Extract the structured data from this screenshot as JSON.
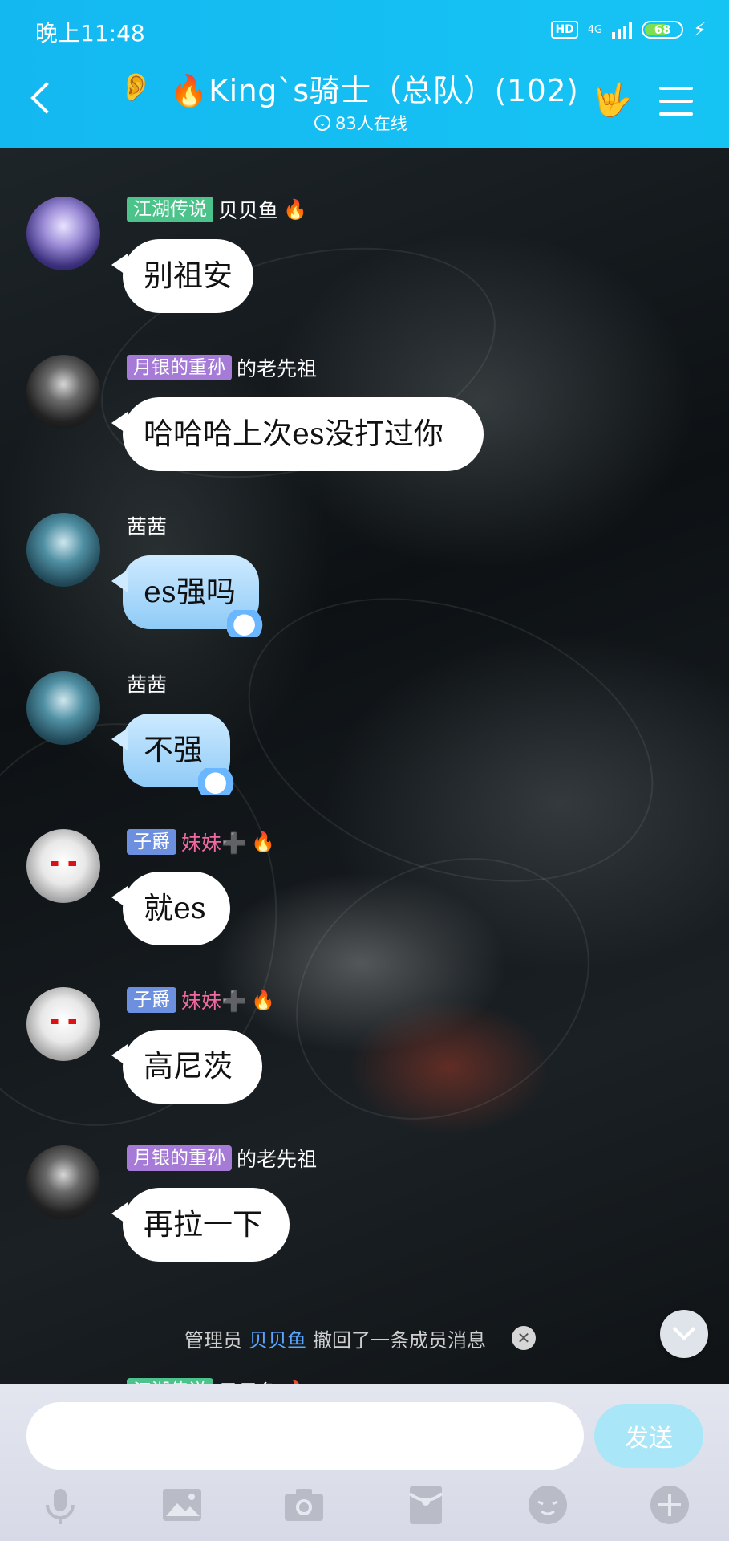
{
  "status_bar": {
    "time": "晚上11:48",
    "hd": "HD",
    "network": "4G",
    "battery": "68",
    "battery_level": 0.68
  },
  "header": {
    "title": "🔥King`s骑士（总队）(102)",
    "online": "83人在线"
  },
  "messages": [
    {
      "badge": "江湖传说",
      "badge_color": "#4cc38a",
      "nick": "贝贝鱼",
      "emoji": "🔥",
      "text": "别祖安",
      "avatar_style": "purple",
      "bubble_style": "white"
    },
    {
      "badge": "月银的重孙",
      "badge_color": "#a67bd8",
      "nick": "的老先祖",
      "emoji": "",
      "text": "哈哈哈上次es没打过你",
      "avatar_style": "dark",
      "bubble_style": "white"
    },
    {
      "badge": "",
      "badge_color": "",
      "nick": "茜茜",
      "emoji": "",
      "text": "es强吗",
      "avatar_style": "teal",
      "bubble_style": "blue"
    },
    {
      "badge": "",
      "badge_color": "",
      "nick": "茜茜",
      "emoji": "",
      "text": "不强",
      "avatar_style": "teal",
      "bubble_style": "blue"
    },
    {
      "badge": "子爵",
      "badge_color": "#6c8fe0",
      "nick": "妹妹➕",
      "emoji": "🔥",
      "text": "就es",
      "avatar_style": "white",
      "bubble_style": "white",
      "nick_color": "pink"
    },
    {
      "badge": "子爵",
      "badge_color": "#6c8fe0",
      "nick": "妹妹➕",
      "emoji": "🔥",
      "text": "高尼茨",
      "avatar_style": "white",
      "bubble_style": "white",
      "nick_color": "pink"
    },
    {
      "badge": "月银的重孙",
      "badge_color": "#a67bd8",
      "nick": "的老先祖",
      "emoji": "",
      "text": "再拉一下",
      "avatar_style": "dark",
      "bubble_style": "white"
    }
  ],
  "system_message": {
    "prefix": "管理员",
    "name": "贝贝鱼",
    "suffix": "撤回了一条成员消息"
  },
  "next_peek": {
    "badge": "江湖传说",
    "nick": "贝贝鱼",
    "emoji": "🔥"
  },
  "input": {
    "placeholder": "",
    "value": "",
    "send_label": "发送"
  },
  "toolbar": {
    "icons": [
      "microphone-icon",
      "image-icon",
      "camera-icon",
      "red-packet-icon",
      "emoji-icon",
      "plus-icon"
    ]
  },
  "colors": {
    "header": "#16c4f4",
    "send_button": "#a9e6f8",
    "system_name": "#5aa6ff"
  }
}
